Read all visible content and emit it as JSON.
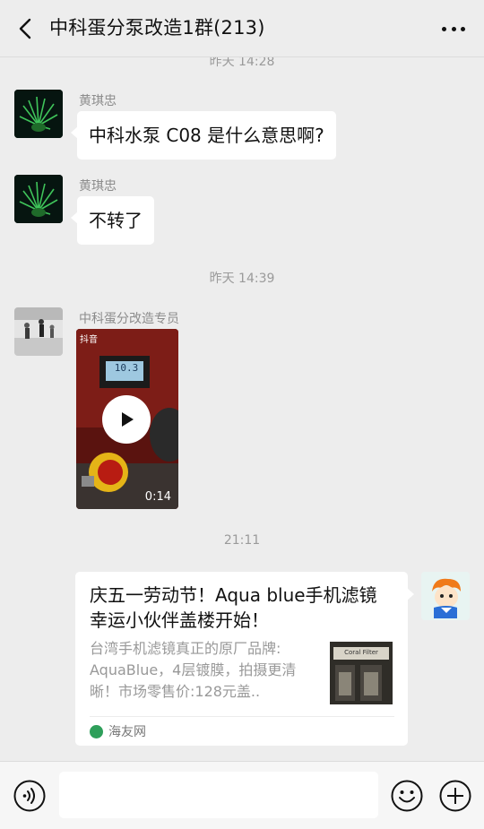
{
  "header": {
    "title": "中科蛋分泵改造1群(213)"
  },
  "messages": {
    "ts_top": "昨天 14:28",
    "msg1": {
      "sender": "黄琪忠",
      "text": "中科水泵 C08 是什么意思啊?"
    },
    "msg2": {
      "sender": "黄琪忠",
      "text": "不转了"
    },
    "ts_mid": "昨天 14:39",
    "msg3": {
      "sender": "中科蛋分改造专员",
      "video_duration": "0:14",
      "video_app": "抖音",
      "video_display": "10.3"
    },
    "ts_last": "21:11",
    "card": {
      "title": "庆五一劳动节！Aqua blue手机滤镜幸运小伙伴盖楼开始！",
      "desc": "台湾手机滤镜真正的原厂品牌: AquaBlue，4层镀膜，拍摄更清晰！市场零售价:128元盖..",
      "thumb_label": "Coral Filter",
      "source": "海友网"
    }
  },
  "colors": {
    "bg": "#ededed",
    "bubble": "#ffffff",
    "source_icon": "#2e9f5a"
  }
}
